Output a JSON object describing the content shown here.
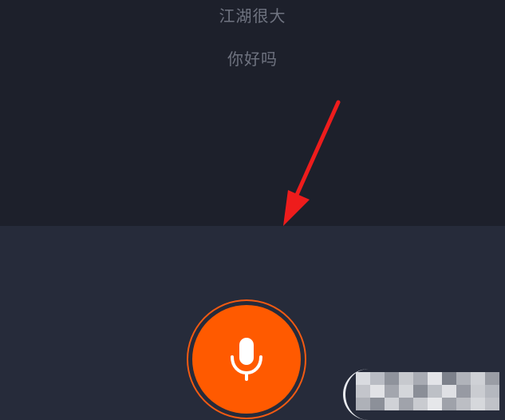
{
  "transcript": {
    "lines": [
      "江湖很大",
      "你好吗"
    ]
  },
  "voice_input": {
    "icon": "microphone-icon",
    "button_color": "#ff5a00",
    "ring_color": "#f25a12"
  },
  "annotation": {
    "icon": "red-arrow",
    "color": "#ee1c1c"
  },
  "colors": {
    "background_top": "#1d202b",
    "background_bottom": "#262b3a",
    "transcript_text": "#6f7380"
  }
}
